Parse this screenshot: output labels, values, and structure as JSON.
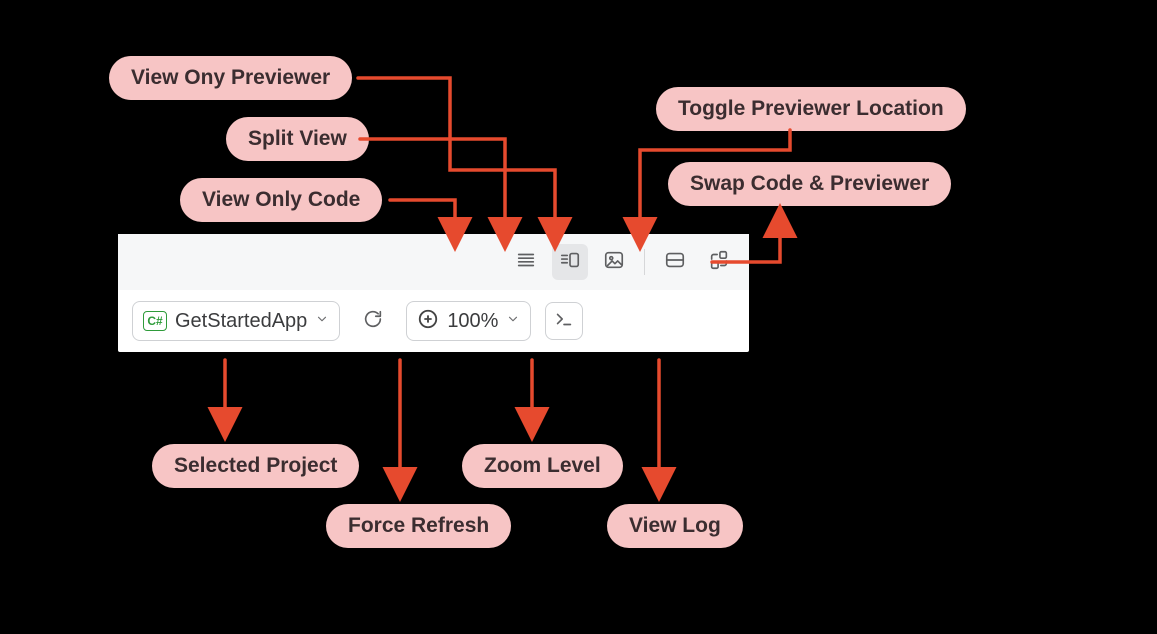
{
  "callouts": {
    "view_only_previewer": "View Ony Previewer",
    "split_view": "Split View",
    "view_only_code": "View Only Code",
    "toggle_previewer_location": "Toggle Previewer Location",
    "swap_code_previewer": "Swap Code & Previewer",
    "selected_project": "Selected Project",
    "force_refresh": "Force Refresh",
    "zoom_level": "Zoom Level",
    "view_log": "View Log"
  },
  "toolbar": {
    "project_badge": "C#",
    "project_name": "GetStartedApp",
    "zoom_value": "100%"
  },
  "colors": {
    "callout_bg": "#f7c5c5",
    "arrow": "#e64a2e",
    "csharp_green": "#2e9b3a"
  }
}
